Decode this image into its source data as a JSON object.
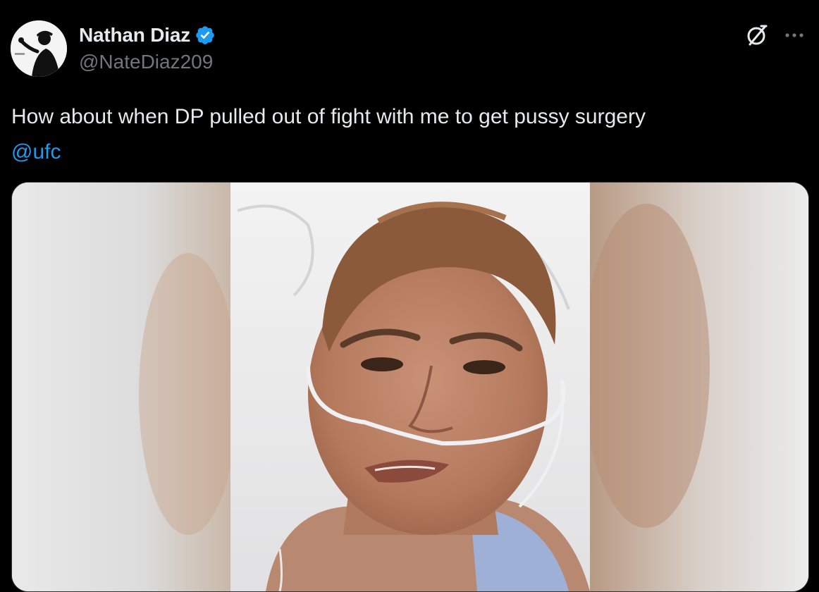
{
  "tweet": {
    "author": {
      "display_name": "Nathan Diaz",
      "handle": "@NateDiaz209",
      "verified": true,
      "verified_color": "#1d9bf0"
    },
    "text_line1": "How about when DP pulled out of fight with me to get pussy surgery",
    "mention": "@ufc",
    "mention_color": "#1d9bf0",
    "icons": {
      "grok": "grok-icon",
      "more": "more-options-icon",
      "verified": "verified-badge-icon"
    },
    "media": {
      "type": "video-thumbnail"
    }
  },
  "colors": {
    "background": "#000000",
    "primary_text": "#e7e9ea",
    "secondary_text": "#71767b",
    "border": "#2f3336"
  }
}
